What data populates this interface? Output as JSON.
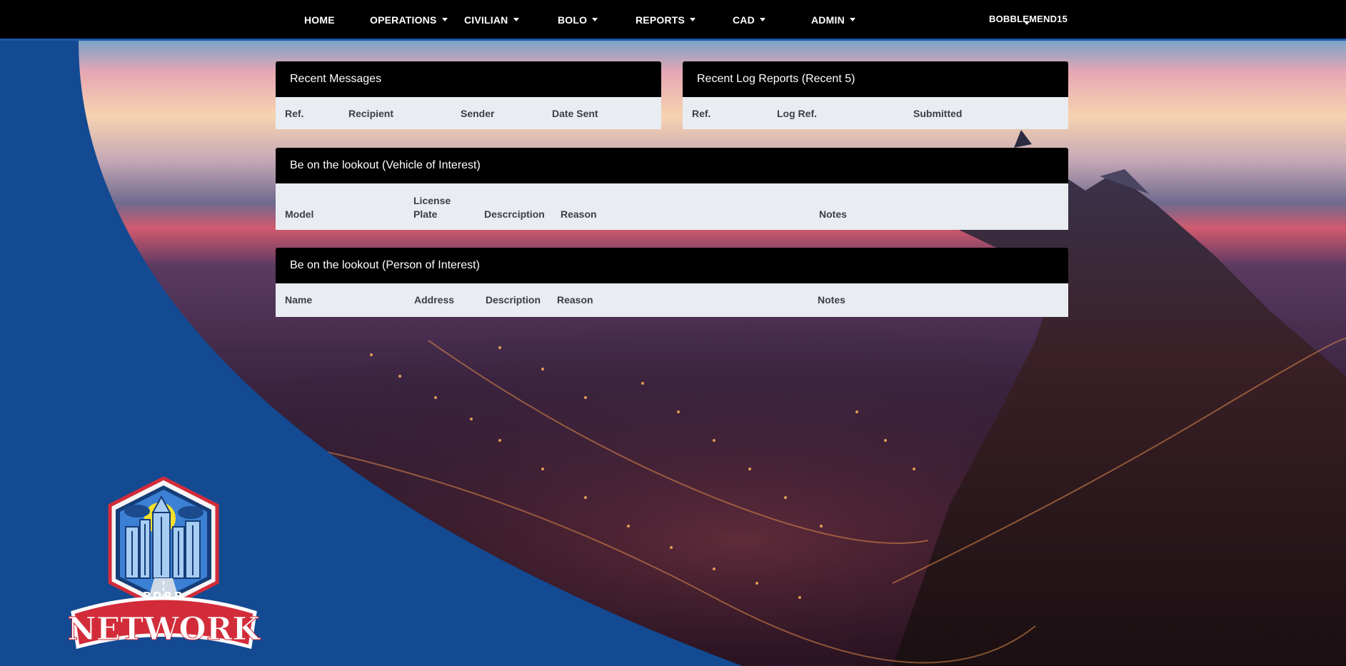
{
  "nav": {
    "items": [
      {
        "label": "HOME",
        "dropdown": false
      },
      {
        "label": "OPERATIONS",
        "dropdown": true
      },
      {
        "label": "CIVILIAN",
        "dropdown": true
      },
      {
        "label": "BOLO",
        "dropdown": true
      },
      {
        "label": "REPORTS",
        "dropdown": true
      },
      {
        "label": "CAD",
        "dropdown": true
      },
      {
        "label": "ADMIN",
        "dropdown": true
      }
    ],
    "user": "BOBBLEMEND15"
  },
  "recent_messages": {
    "title": "Recent Messages",
    "columns": [
      "Ref.",
      "Recipient",
      "Sender",
      "Date Sent"
    ]
  },
  "recent_logs": {
    "title": "Recent Log Reports (Recent 5)",
    "columns": [
      "Ref.",
      "Log Ref.",
      "Submitted"
    ]
  },
  "bolo_vehicle": {
    "title": "Be on the lookout (Vehicle of Interest)",
    "columns": [
      "Model",
      "License Plate",
      "Descrciption",
      "Reason",
      "Notes"
    ]
  },
  "bolo_person": {
    "title": "Be on the lookout (Person of Interest)",
    "columns": [
      "Name",
      "Address",
      "Description",
      "Reason",
      "Notes"
    ]
  },
  "logo": {
    "top_text": "PDRP",
    "main_text": "NETWORK"
  },
  "colors": {
    "navbar": "#000000",
    "accent_blue": "#1f57a8",
    "panel_header": "#000000",
    "panel_body": "#e9edf1"
  }
}
